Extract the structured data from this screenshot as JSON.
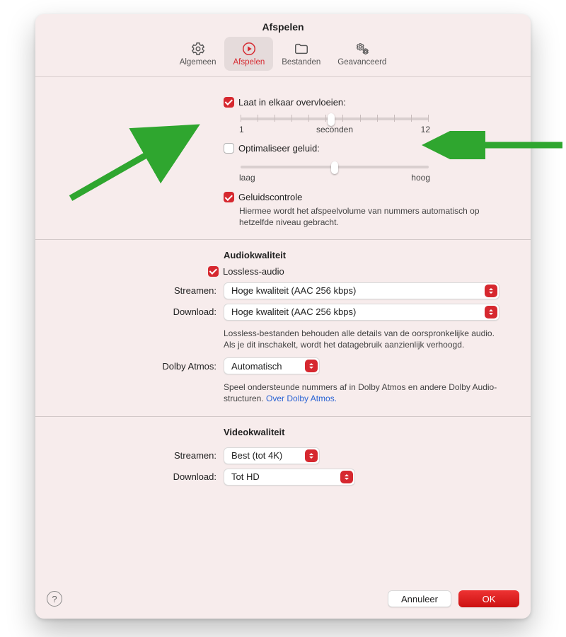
{
  "window": {
    "title": "Afspelen"
  },
  "tabs": {
    "general": {
      "label": "Algemeen"
    },
    "playback": {
      "label": "Afspelen"
    },
    "files": {
      "label": "Bestanden"
    },
    "advanced": {
      "label": "Geavanceerd"
    }
  },
  "crossfade": {
    "label": "Laat in elkaar overvloeien:",
    "checked": true,
    "min_label": "1",
    "unit_label": "seconden",
    "max_label": "12",
    "value_percent": 48
  },
  "equalizer": {
    "label": "Optimaliseer geluid:",
    "checked": false,
    "low_label": "laag",
    "high_label": "hoog",
    "value_percent": 50
  },
  "sound_check": {
    "label": "Geluidscontrole",
    "checked": true,
    "description": "Hiermee wordt het afspeelvolume van nummers automatisch op hetzelfde niveau gebracht."
  },
  "audio_quality": {
    "heading": "Audiokwaliteit",
    "lossless": {
      "label": "Lossless-audio",
      "checked": true
    },
    "stream": {
      "label": "Streamen:",
      "value": "Hoge kwaliteit (AAC 256 kbps)"
    },
    "download": {
      "label": "Download:",
      "value": "Hoge kwaliteit (AAC 256 kbps)"
    },
    "note": "Lossless-bestanden behouden alle details van de oorspronkelijke audio. Als je dit inschakelt, wordt het datagebruik aanzienlijk verhoogd."
  },
  "dolby": {
    "label": "Dolby Atmos:",
    "value": "Automatisch",
    "note_prefix": "Speel ondersteunde nummers af in Dolby Atmos en andere Dolby Audio-structuren. ",
    "link_text": "Over Dolby Atmos."
  },
  "video_quality": {
    "heading": "Videokwaliteit",
    "stream": {
      "label": "Streamen:",
      "value": "Best (tot 4K)"
    },
    "download": {
      "label": "Download:",
      "value": "Tot HD"
    }
  },
  "footer": {
    "help": "?",
    "cancel": "Annuleer",
    "ok": "OK"
  }
}
